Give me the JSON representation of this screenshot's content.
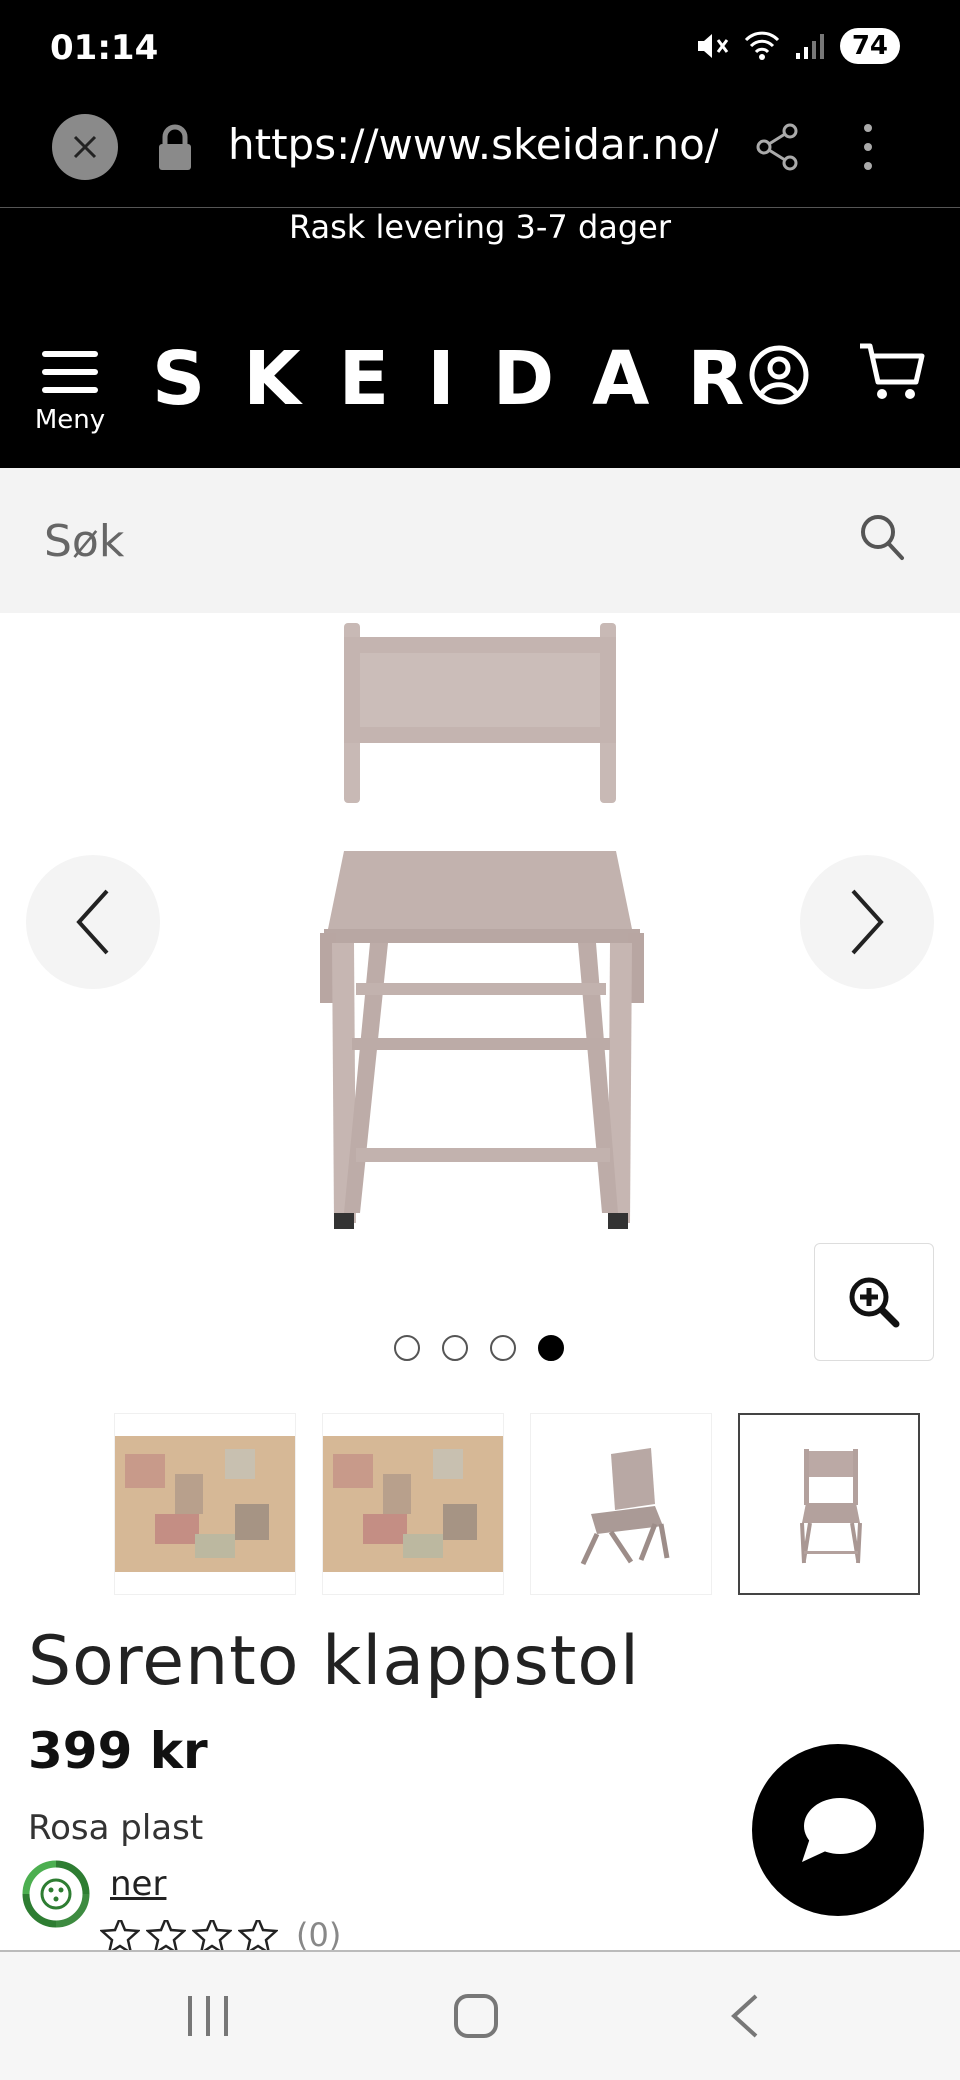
{
  "status_bar": {
    "time": "01:14",
    "battery": "74"
  },
  "browser": {
    "url": "https://www.skeidar.no/al"
  },
  "promo": {
    "text": "Rask levering 3-7 dager"
  },
  "header": {
    "menu_label": "Meny",
    "logo": "SKEIDAR",
    "icons": [
      "hamburger-icon",
      "account-icon",
      "cart-icon"
    ]
  },
  "search": {
    "placeholder": "Søk"
  },
  "gallery": {
    "image_count": 4,
    "active_index": 4,
    "thumbnails": [
      {
        "name": "lifestyle-photo-1",
        "selected": false
      },
      {
        "name": "lifestyle-photo-2",
        "selected": false
      },
      {
        "name": "chair-angled",
        "selected": false
      },
      {
        "name": "chair-front",
        "selected": true
      }
    ]
  },
  "product": {
    "title": "Sorento klappstol",
    "price": "399 kr",
    "variant": "Rosa plast",
    "reviews_link": "ner",
    "review_count": "(0)",
    "rating": 0,
    "rating_max": 5
  },
  "colors": {
    "header_bg": "#000000",
    "search_bg": "#f3f3f3",
    "chair_pink": "#c9b8b4",
    "eco_green": "#2e7d32"
  }
}
